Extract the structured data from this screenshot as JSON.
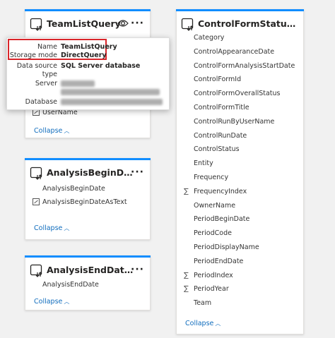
{
  "team_card": {
    "title": "TeamListQuery",
    "hidden_field": "UserName",
    "collapse_label": "Collapse"
  },
  "tooltip": {
    "name_key": "Name",
    "name_value": "TeamListQuery",
    "storage_key": "Storage mode",
    "storage_value": "DirectQuery",
    "source_key": "Data source",
    "source_key2": "type",
    "source_value": "SQL Server database",
    "server_key": "Server",
    "database_key": "Database"
  },
  "begin_card": {
    "title": "AnalysisBeginDateListQ...",
    "fields": [
      "AnalysisBeginDate",
      "AnalysisBeginDateAsText"
    ],
    "collapse_label": "Collapse"
  },
  "end_card": {
    "title": "AnalysisEndDateListQu...",
    "fields": [
      "AnalysisEndDate"
    ],
    "collapse_label": "Collapse"
  },
  "control_card": {
    "title": "ControlFormStatusQuery",
    "fields": [
      {
        "name": "Category",
        "sigma": false
      },
      {
        "name": "ControlAppearanceDate",
        "sigma": false
      },
      {
        "name": "ControlFormAnalysisStartDate",
        "sigma": false
      },
      {
        "name": "ControlFormId",
        "sigma": false
      },
      {
        "name": "ControlFormOverallStatus",
        "sigma": false
      },
      {
        "name": "ControlFormTitle",
        "sigma": false
      },
      {
        "name": "ControlRunByUserName",
        "sigma": false
      },
      {
        "name": "ControlRunDate",
        "sigma": false
      },
      {
        "name": "ControlStatus",
        "sigma": false
      },
      {
        "name": "Entity",
        "sigma": false
      },
      {
        "name": "Frequency",
        "sigma": false
      },
      {
        "name": "FrequencyIndex",
        "sigma": true
      },
      {
        "name": "OwnerName",
        "sigma": false
      },
      {
        "name": "PeriodBeginDate",
        "sigma": false
      },
      {
        "name": "PeriodCode",
        "sigma": false
      },
      {
        "name": "PeriodDisplayName",
        "sigma": false
      },
      {
        "name": "PeriodEndDate",
        "sigma": false
      },
      {
        "name": "PeriodIndex",
        "sigma": true
      },
      {
        "name": "PeriodYear",
        "sigma": true
      },
      {
        "name": "Team",
        "sigma": false
      }
    ],
    "collapse_label": "Collapse"
  },
  "colors": {
    "accent": "#118dff",
    "highlight": "#d9252a",
    "link": "#0f6cbd"
  },
  "icons": {
    "table": "table-query-icon",
    "more": "more-options-icon",
    "eye": "eye-icon",
    "sigma": "sigma-icon",
    "calc": "calculated-column-icon",
    "chevron": "chevron-up-icon"
  }
}
